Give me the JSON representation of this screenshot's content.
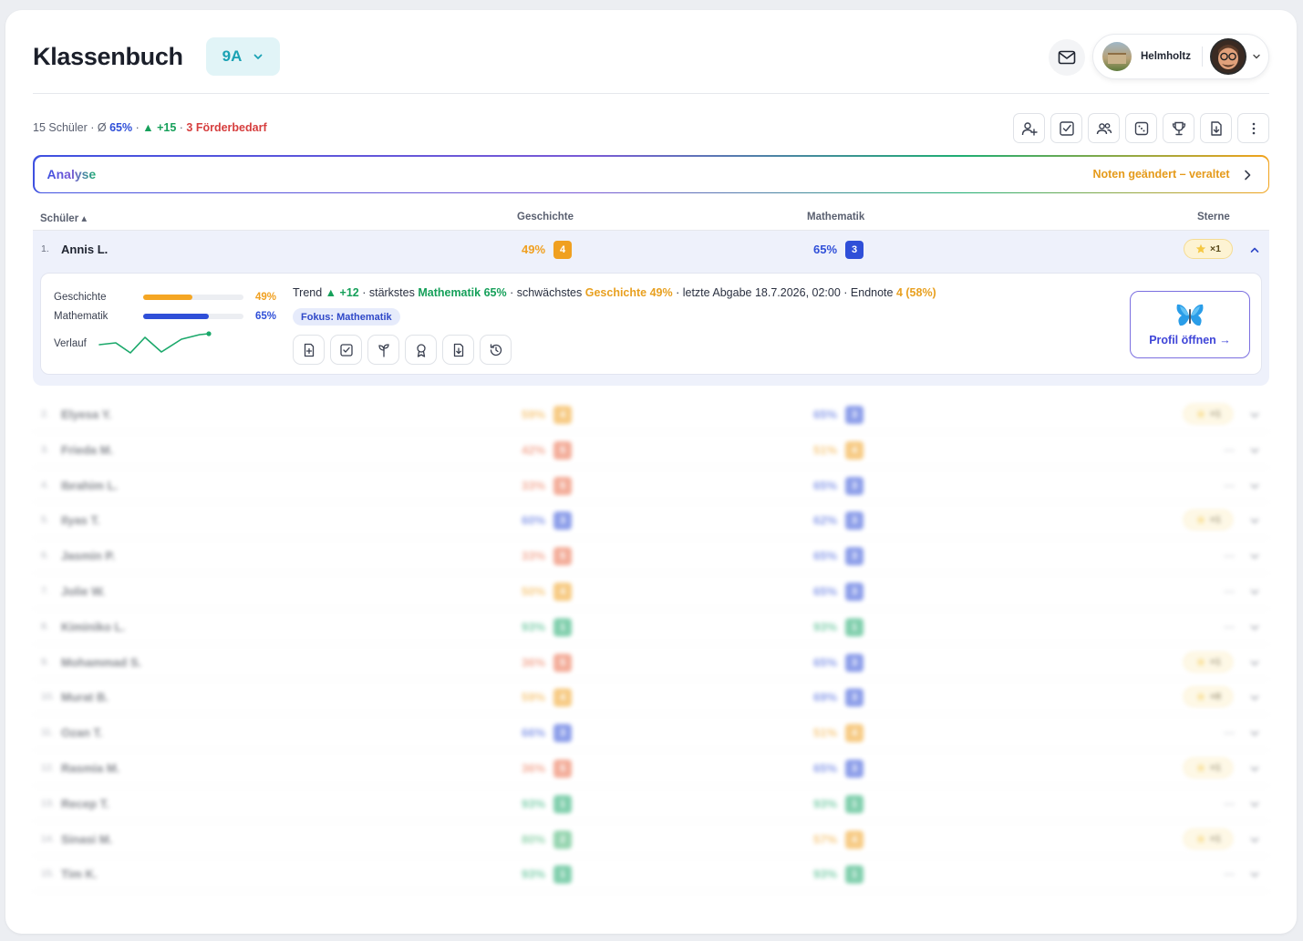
{
  "header": {
    "title": "Klassenbuch",
    "class_selected": "9A",
    "school_name": "Helmholtz"
  },
  "stats": {
    "count_label": "15 Schüler",
    "sep1": " · Ø ",
    "avg": "65%",
    "sep2": " · ",
    "trend": "▲ +15",
    "sep3": " · ",
    "foerder": "3 Förderbedarf"
  },
  "toolbar_icons": [
    "add-user-icon",
    "check-square-icon",
    "users-icon",
    "dice-icon",
    "trophy-icon",
    "download-icon",
    "more-vertical-icon"
  ],
  "analyse": {
    "label": "Analyse",
    "status": "Noten geändert – veraltet"
  },
  "columns": {
    "student": "Schüler ▴",
    "geschichte": "Geschichte",
    "mathematik": "Mathematik",
    "sterne": "Sterne"
  },
  "colors": {
    "grade_1": "#1aa86a",
    "grade_2": "#3fb26e",
    "grade_3": "#2f4fd8",
    "grade_4": "#f0a020",
    "grade_5": "#ea6a47",
    "accent": "#3f45d8"
  },
  "expanded": {
    "idx": "1.",
    "name": "Annis L.",
    "geschichte_pct": "49%",
    "geschichte_grade": "4",
    "mathematik_pct": "65%",
    "mathematik_grade": "3",
    "stars": "×1",
    "bars": [
      {
        "label": "Geschichte",
        "value": "49%",
        "fraction": 0.49,
        "color": "#f5a623"
      },
      {
        "label": "Mathematik",
        "value": "65%",
        "fraction": 0.65,
        "color": "#2f4fd8"
      }
    ],
    "verlauf_label": "Verlauf",
    "trend_prefix": "Trend ",
    "trend_value": "▲ +12",
    "t_sep1": " · stärkstes ",
    "strongest": "Mathematik 65%",
    "t_sep2": " · schwächstes ",
    "weakest": "Geschichte 49%",
    "t_sep3": " · letzte Abgabe 18.7.2026, 02:00 · Endnote ",
    "endnote": "4 (58%)",
    "fokus": "Fokus: Mathematik",
    "action_icons": [
      "file-plus-icon",
      "check-square-icon",
      "sprout-icon",
      "award-icon",
      "download-icon",
      "history-icon"
    ],
    "profile_button": "Profil öffnen →"
  },
  "students": [
    {
      "idx": "2.",
      "name": "Elyesa Y.",
      "g_pct": "59%",
      "g_grade": "4",
      "m_pct": "65%",
      "m_grade": "3",
      "stars": "×1"
    },
    {
      "idx": "3.",
      "name": "Frieda M.",
      "g_pct": "42%",
      "g_grade": "5",
      "m_pct": "51%",
      "m_grade": "4",
      "stars": "—"
    },
    {
      "idx": "4.",
      "name": "Ibrahim L.",
      "g_pct": "33%",
      "g_grade": "5",
      "m_pct": "65%",
      "m_grade": "3",
      "stars": "—"
    },
    {
      "idx": "5.",
      "name": "Ilyas T.",
      "g_pct": "60%",
      "g_grade": "3",
      "m_pct": "62%",
      "m_grade": "3",
      "stars": "×1"
    },
    {
      "idx": "6.",
      "name": "Jasmin P.",
      "g_pct": "33%",
      "g_grade": "5",
      "m_pct": "65%",
      "m_grade": "3",
      "stars": "—"
    },
    {
      "idx": "7.",
      "name": "Jolie W.",
      "g_pct": "50%",
      "g_grade": "4",
      "m_pct": "65%",
      "m_grade": "3",
      "stars": "—"
    },
    {
      "idx": "8.",
      "name": "Kiminiko L.",
      "g_pct": "93%",
      "g_grade": "1",
      "m_pct": "93%",
      "m_grade": "1",
      "stars": "—"
    },
    {
      "idx": "9.",
      "name": "Mohammad S.",
      "g_pct": "36%",
      "g_grade": "5",
      "m_pct": "65%",
      "m_grade": "3",
      "stars": "×1"
    },
    {
      "idx": "10.",
      "name": "Murat B.",
      "g_pct": "59%",
      "g_grade": "4",
      "m_pct": "69%",
      "m_grade": "3",
      "stars": "×8"
    },
    {
      "idx": "11.",
      "name": "Ozan T.",
      "g_pct": "66%",
      "g_grade": "3",
      "m_pct": "51%",
      "m_grade": "4",
      "stars": "—"
    },
    {
      "idx": "12.",
      "name": "Rasmia M.",
      "g_pct": "36%",
      "g_grade": "5",
      "m_pct": "65%",
      "m_grade": "3",
      "stars": "×1"
    },
    {
      "idx": "13.",
      "name": "Recep T.",
      "g_pct": "93%",
      "g_grade": "1",
      "m_pct": "93%",
      "m_grade": "1",
      "stars": "—"
    },
    {
      "idx": "14.",
      "name": "Sinasi M.",
      "g_pct": "80%",
      "g_grade": "2",
      "m_pct": "57%",
      "m_grade": "4",
      "stars": "×1"
    },
    {
      "idx": "15.",
      "name": "Tim K.",
      "g_pct": "93%",
      "g_grade": "1",
      "m_pct": "93%",
      "m_grade": "1",
      "stars": "—"
    }
  ]
}
